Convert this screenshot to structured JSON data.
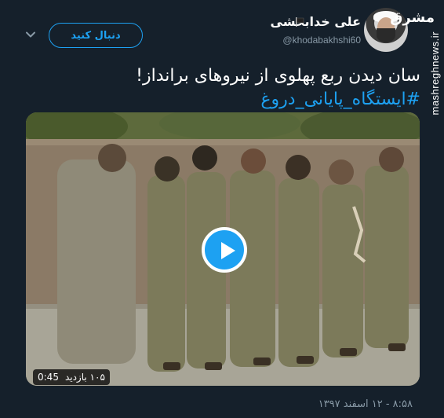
{
  "watermark": {
    "logo": "مشرق",
    "site": "mashreghnews.ir"
  },
  "author": {
    "display_name": "علی خدابخشی",
    "handle": "@khodabakhshi60",
    "flag_icon": "black-flag-icon"
  },
  "follow_label": "دنبال کنید",
  "menu_icon": "chevron-down-icon",
  "tweet": {
    "text": "سان دیدن ربع پهلوی از نیروهای برانداز!",
    "hashtag": "#ایستگاه_پایانی_دروغ"
  },
  "video": {
    "duration": "0:45",
    "views": "۱۰۵ بازدید",
    "play_icon": "play-icon"
  },
  "timestamp": "۸:۵۸ - ۱۲ اسفند ۱۳۹۷",
  "colors": {
    "background": "#15202b",
    "accent": "#1da1f2",
    "muted": "#8899a6"
  }
}
